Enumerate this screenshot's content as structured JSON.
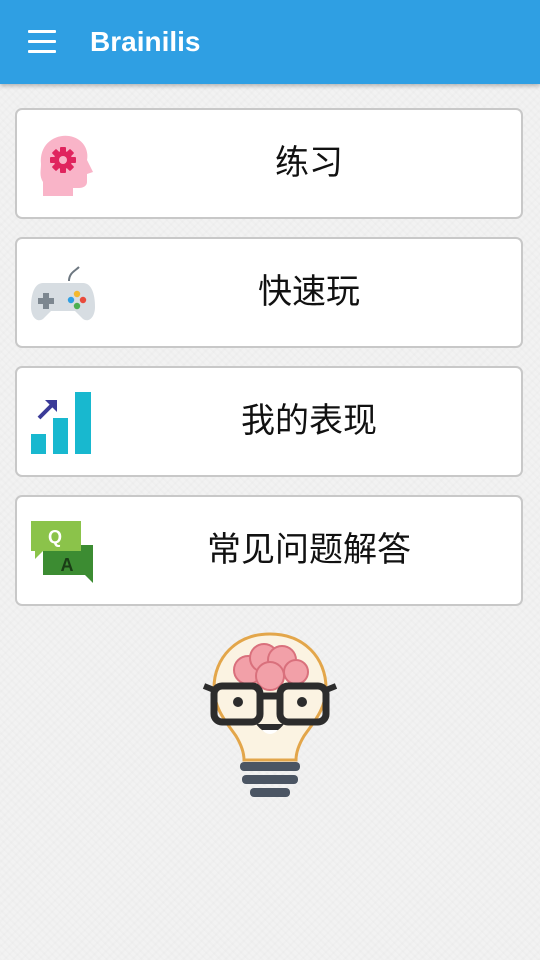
{
  "app_bar": {
    "title": "Brainilis",
    "menu_icon": "hamburger-menu-icon",
    "color": "#2f9fe3"
  },
  "menu": {
    "items": [
      {
        "label": "练习",
        "icon": "brain-gear-icon"
      },
      {
        "label": "快速玩",
        "icon": "gamepad-icon"
      },
      {
        "label": "我的表现",
        "icon": "bar-chart-icon"
      },
      {
        "label": "常见问题解答",
        "icon": "faq-qa-icon"
      }
    ]
  },
  "mascot": {
    "icon": "lightbulb-brain-mascot"
  }
}
